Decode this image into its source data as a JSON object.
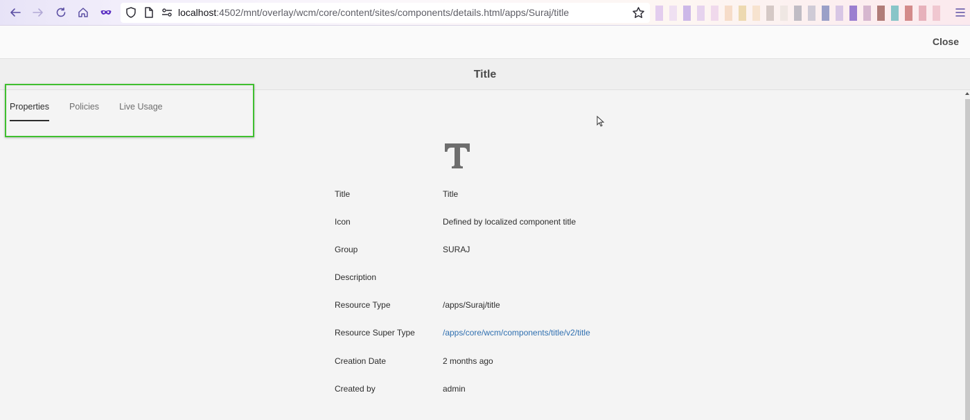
{
  "browser": {
    "url_host": "localhost",
    "url_path": ":4502/mnt/overlay/wcm/core/content/sites/components/details.html/apps/Suraj/title",
    "bookmark_colors": [
      "#e3cdee",
      "#efe0f2",
      "#ccb8e8",
      "#e6d3ee",
      "#f0d9ec",
      "#f6dcc9",
      "#edd9b0",
      "#f7e3cf",
      "#d5c9c6",
      "#efe7e3",
      "#c0bcc4",
      "#cfcbd6",
      "#9aa0c8",
      "#d8c6e5",
      "#9b7fd0",
      "#d6b7cf",
      "#b07c78",
      "#88c5c8",
      "#d38a8a",
      "#e7b1bb",
      "#f0c7d0"
    ]
  },
  "header": {
    "close_label": "Close",
    "title": "Title"
  },
  "tabs": [
    {
      "label": "Properties"
    },
    {
      "label": "Policies"
    },
    {
      "label": "Live Usage"
    }
  ],
  "component_icon": "title-text-icon",
  "details": [
    {
      "label": "Title",
      "value": "Title"
    },
    {
      "label": "Icon",
      "value": "Defined by localized component title"
    },
    {
      "label": "Group",
      "value": "SURAJ"
    },
    {
      "label": "Description",
      "value": ""
    },
    {
      "label": "Resource Type",
      "value": "/apps/Suraj/title"
    },
    {
      "label": "Resource Super Type",
      "value": "/apps/core/wcm/components/title/v2/title"
    },
    {
      "label": "Creation Date",
      "value": "2 months ago"
    },
    {
      "label": "Created by",
      "value": "admin"
    }
  ],
  "colors": {
    "accent_link": "#2f6fb0",
    "highlight_box": "#3fbf2f"
  }
}
